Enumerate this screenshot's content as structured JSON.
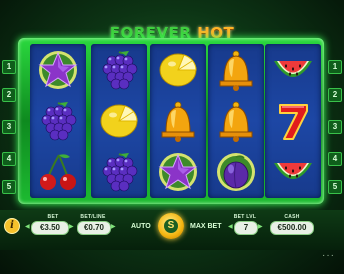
{
  "game": {
    "title_word1": "FOREVER",
    "title_word2": "HOT"
  },
  "paylines": {
    "left": [
      "1",
      "2",
      "3",
      "4",
      "5"
    ],
    "right": [
      "1",
      "2",
      "3",
      "4",
      "5"
    ]
  },
  "reels": [
    [
      "star-icon",
      "grapes-icon",
      "cherry-icon"
    ],
    [
      "grapes-icon",
      "lemon-icon",
      "grapes-icon"
    ],
    [
      "lemon-icon",
      "bell-icon",
      "star-icon"
    ],
    [
      "bell-icon",
      "bell-icon",
      "plum-icon"
    ],
    [
      "watermelon-icon",
      "seven-icon",
      "watermelon-icon"
    ]
  ],
  "controls": {
    "bet_label": "BET",
    "bet_value": "€3.50",
    "betline_label": "BET/LINE",
    "betline_value": "€0.70",
    "auto_label": "AUTO",
    "spin_label": "S",
    "maxbet_label": "MAX BET",
    "betlvl_label": "BET LVL",
    "betlvl_value": "7",
    "cash_label": "CASH",
    "cash_value": "€500.00",
    "info_label": "i",
    "menu_label": "···"
  },
  "colors": {
    "frame_green": "#1dbb31",
    "reel_blue": "#1d47a5",
    "gold": "#f3b40f"
  }
}
